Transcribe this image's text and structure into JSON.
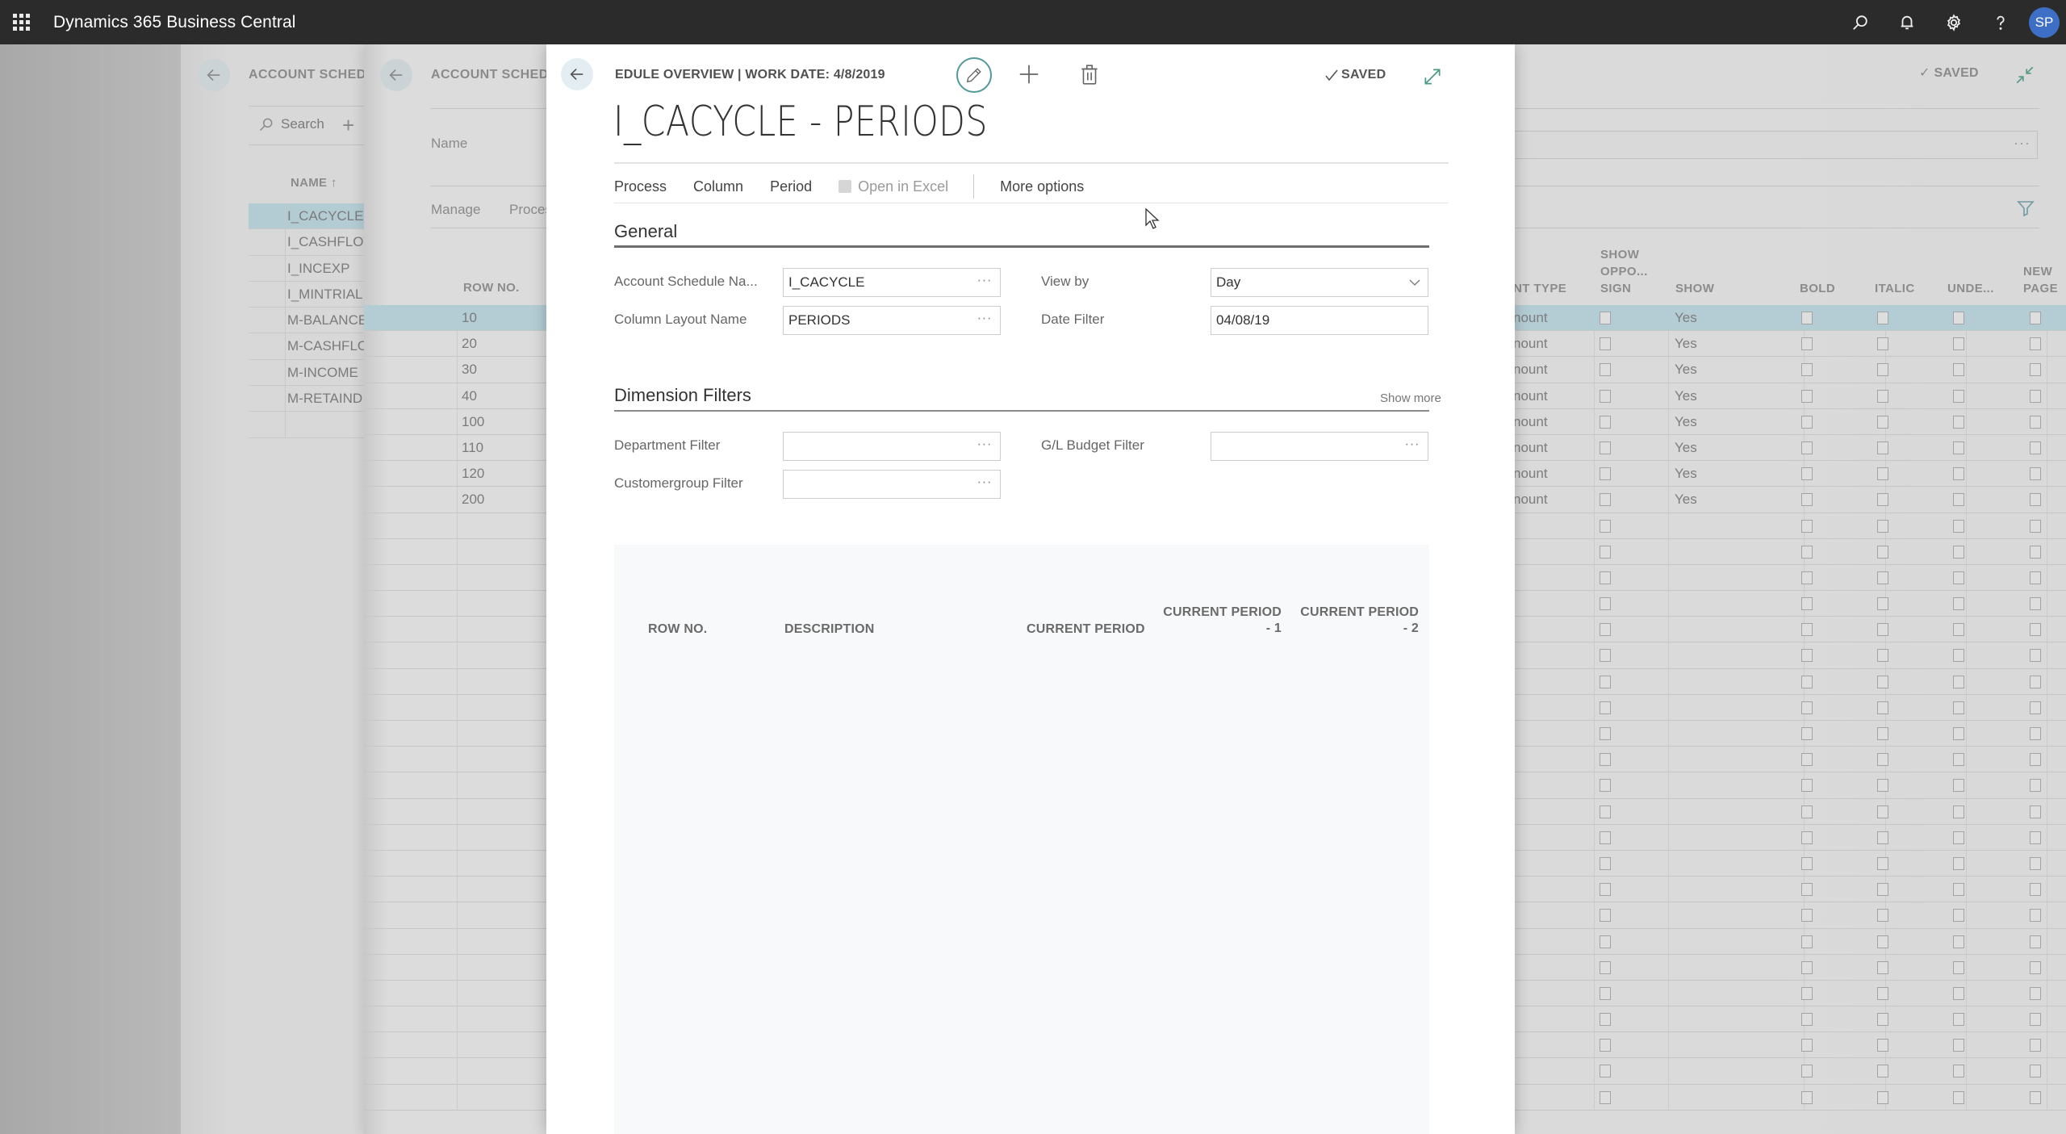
{
  "app": {
    "title": "Dynamics 365 Business Central",
    "user_initials": "SP",
    "icons": [
      "waffle-icon",
      "search-icon",
      "bell-icon",
      "gear-icon",
      "help-icon"
    ]
  },
  "background_panel_1": {
    "caption": "ACCOUNT SCHEDU",
    "search_label": "Search",
    "column_header": "NAME ↑",
    "rows": [
      "I_CACYCLE",
      "I_CASHFLOW",
      "I_INCEXP",
      "I_MINTRIAL",
      "M-BALANCE",
      "M-CASHFLOW",
      "M-INCOME",
      "M-RETAIND",
      ""
    ],
    "selected_index": 0
  },
  "background_panel_2": {
    "caption": "ACCOUNT SCHEDU",
    "name_label": "Name",
    "actions": [
      "Manage",
      "Process"
    ],
    "saved_label": "SAVED",
    "columns": {
      "row_no": "ROW NO.",
      "amount_type": "NT TYPE",
      "show_opposite_sign": [
        "SHOW",
        "OPPO...",
        "SIGN"
      ],
      "show": "SHOW",
      "bold": "BOLD",
      "italic": "ITALIC",
      "underline": "UNDE...",
      "new_page": [
        "NEW",
        "PAGE"
      ]
    },
    "rows": [
      {
        "row_no": "10",
        "amount_type": "nount",
        "show": "Yes"
      },
      {
        "row_no": "20",
        "amount_type": "nount",
        "show": "Yes"
      },
      {
        "row_no": "30",
        "amount_type": "nount",
        "show": "Yes"
      },
      {
        "row_no": "40",
        "amount_type": "nount",
        "show": "Yes"
      },
      {
        "row_no": "100",
        "amount_type": "nount",
        "show": "Yes"
      },
      {
        "row_no": "110",
        "amount_type": "nount",
        "show": "Yes"
      },
      {
        "row_no": "120",
        "amount_type": "nount",
        "show": "Yes"
      },
      {
        "row_no": "200",
        "amount_type": "nount",
        "show": "Yes"
      }
    ],
    "selected_index": 0
  },
  "modal": {
    "caption": "EDULE OVERVIEW | WORK DATE: 4/8/2019",
    "title": "I_CACYCLE - PERIODS",
    "saved_label": "SAVED",
    "actions": {
      "process": "Process",
      "column": "Column",
      "period": "Period",
      "open_in_excel": "Open in Excel",
      "more_options": "More options"
    },
    "general": {
      "heading": "General",
      "account_schedule_name": {
        "label": "Account Schedule Na...",
        "value": "I_CACYCLE"
      },
      "column_layout_name": {
        "label": "Column Layout Name",
        "value": "PERIODS"
      },
      "view_by": {
        "label": "View by",
        "value": "Day"
      },
      "date_filter": {
        "label": "Date Filter",
        "value": "04/08/19"
      }
    },
    "dimension_filters": {
      "heading": "Dimension Filters",
      "show_more": "Show more",
      "department_filter": {
        "label": "Department Filter",
        "value": ""
      },
      "gl_budget_filter": {
        "label": "G/L Budget Filter",
        "value": ""
      },
      "customergroup_filter": {
        "label": "Customergroup Filter",
        "value": ""
      }
    },
    "grid": {
      "columns": {
        "row_no": "ROW NO.",
        "description": "DESCRIPTION",
        "current_period": "CURRENT PERIOD",
        "current_period_1_top": "CURRENT PERIOD",
        "current_period_1_bottom": "- 1",
        "current_period_2_top": "CURRENT PERIOD",
        "current_period_2_bottom": "- 2"
      },
      "rows": []
    }
  }
}
